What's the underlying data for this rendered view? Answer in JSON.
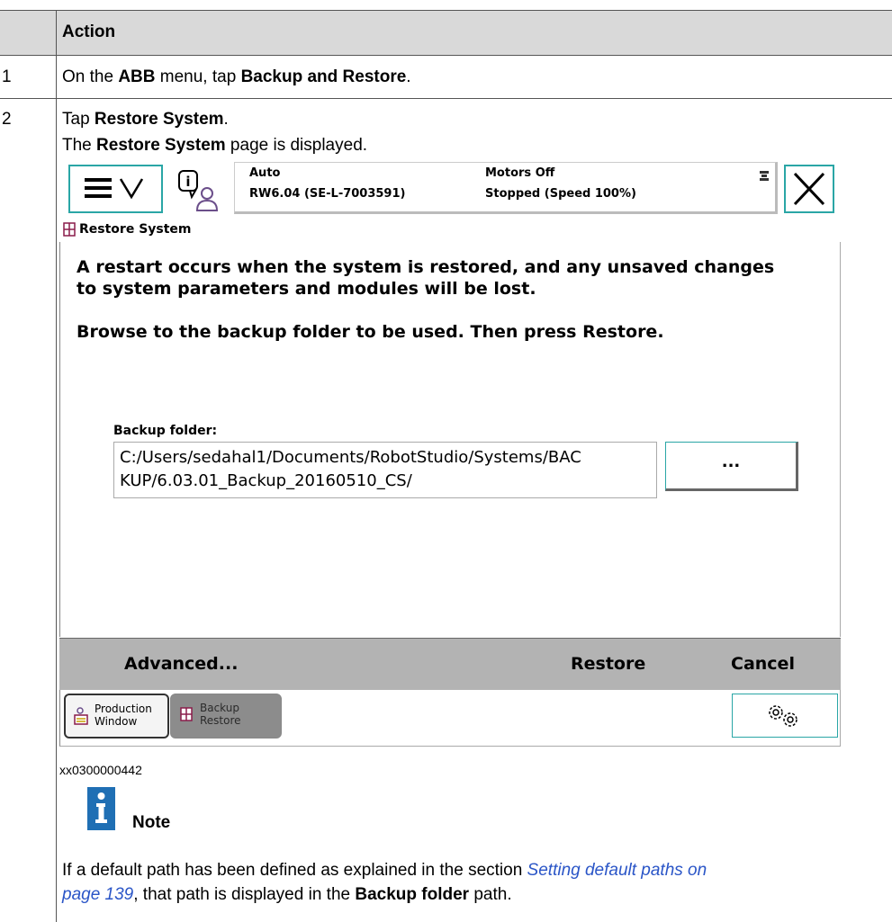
{
  "table": {
    "header": "Action",
    "rows": [
      {
        "num": "1",
        "parts": [
          "On the ",
          "ABB",
          " menu, tap ",
          "Backup and Restore",
          "."
        ]
      },
      {
        "num": "2",
        "line1": [
          "Tap ",
          "Restore System",
          "."
        ],
        "line2": [
          "The ",
          "Restore System",
          " page is displayed."
        ]
      }
    ]
  },
  "flexpendant": {
    "status": {
      "mode": "Auto",
      "system": "RW6.04 (SE-L-7003591)",
      "motors": "Motors Off",
      "state": "Stopped (Speed 100%)"
    },
    "page_title": "Restore System",
    "message1_line1": "A restart occurs when the system is restored, and any unsaved changes",
    "message1_line2": "to system parameters and modules will be lost.",
    "message2": "Browse to the backup folder to be used. Then press Restore.",
    "folder_label": "Backup folder:",
    "folder_path_line1": "C:/Users/sedahal1/Documents/RobotStudio/Systems/BAC",
    "folder_path_line2": "KUP/6.03.01_Backup_20160510_CS/",
    "browse_label": "...",
    "commands": {
      "advanced": "Advanced...",
      "restore": "Restore",
      "cancel": "Cancel"
    },
    "taskbar": {
      "task1_line1": "Production",
      "task1_line2": "Window",
      "task2_line1": "Backup",
      "task2_line2": "Restore"
    },
    "icons": {
      "menu": "hamburger-chevron-icon",
      "event_log": "info-person-icon",
      "close": "close-icon",
      "settings": "gears-icon",
      "page": "backup-icon"
    },
    "accent_color": "#2aa6a6"
  },
  "caption": "xx0300000442",
  "note": {
    "title": "Note",
    "text_parts": [
      "If a default path has been defined as explained in the section ",
      "Setting default paths on",
      "page 139",
      ", that path is displayed in the ",
      "Backup folder",
      " path."
    ]
  }
}
